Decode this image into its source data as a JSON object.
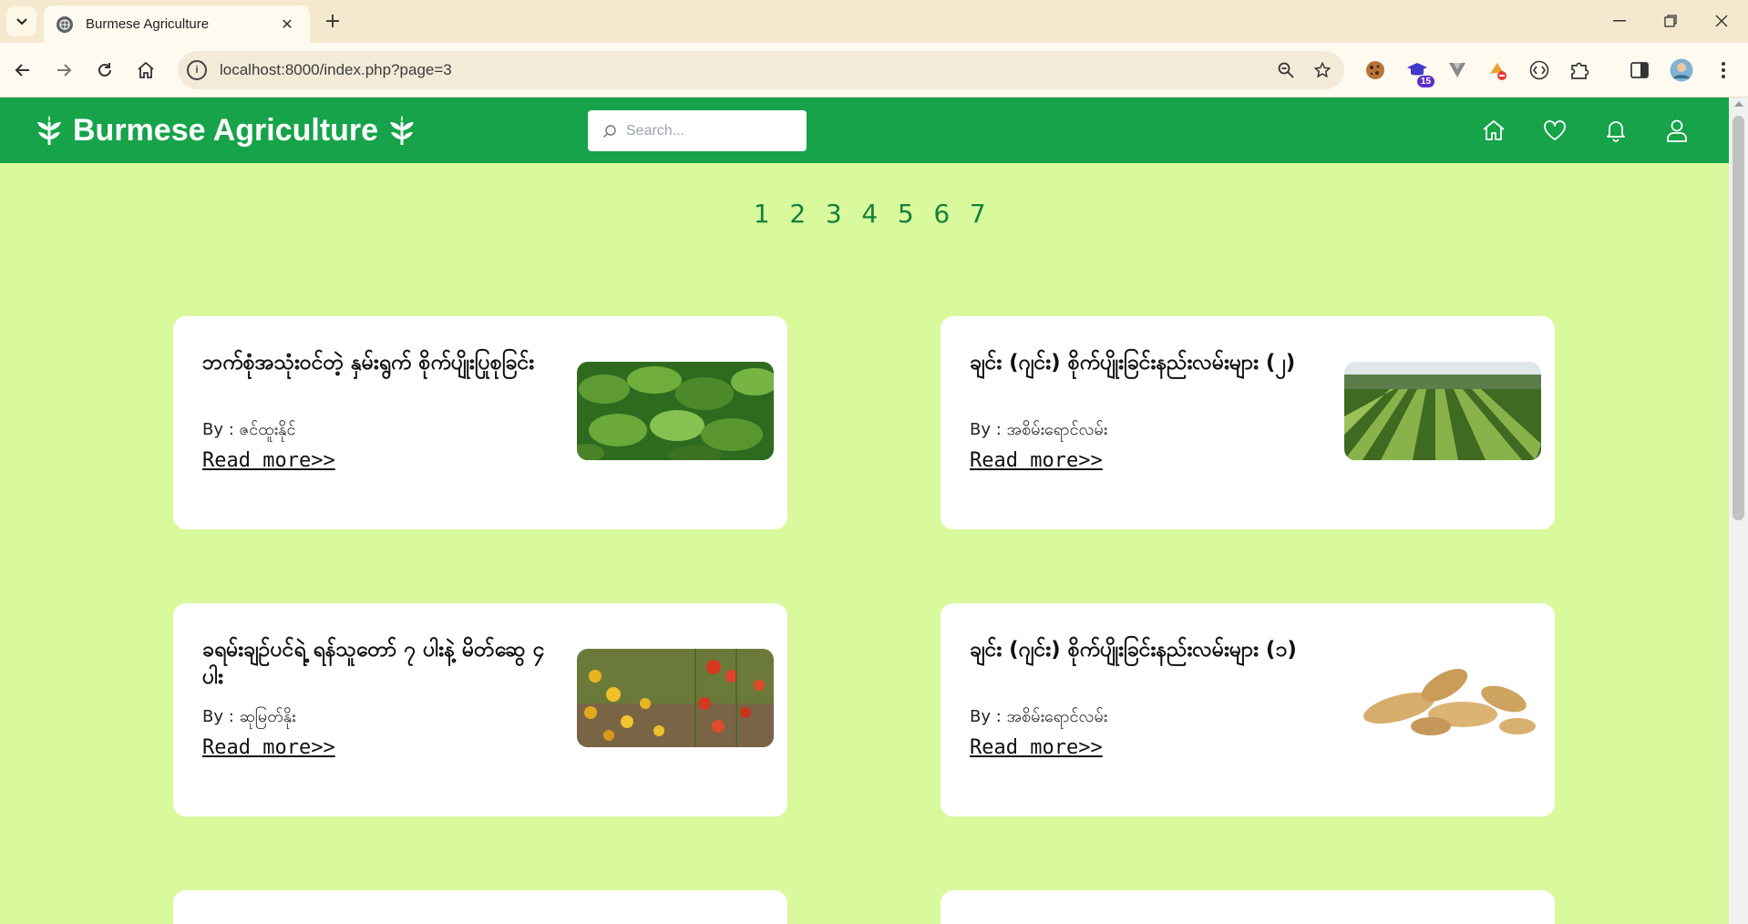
{
  "browser": {
    "tab_title": "Burmese Agriculture",
    "url": "localhost:8000/index.php?page=3",
    "extension_badge": "15"
  },
  "site": {
    "title": "Burmese Agriculture",
    "search_placeholder": "Search...",
    "accent_color": "#16a34a",
    "background_color": "#d9f99d"
  },
  "pagination": {
    "pages": [
      "1",
      "2",
      "3",
      "4",
      "5",
      "6",
      "7"
    ],
    "current": "3"
  },
  "posts": [
    {
      "title": "ဘက်စုံအသုံးဝင်တဲ့ နှမ်းရွက် စိုက်ပျိုးပြုစုခြင်း",
      "author": "By  :  ဇင်ထူးနိုင်",
      "read_more": "Read more>>"
    },
    {
      "title": "ချင်း (ဂျင်း) စိုက်ပျိုးခြင်းနည်းလမ်းများ (၂)",
      "author": "By  :  အစိမ်းရောင်လမ်း",
      "read_more": "Read more>>"
    },
    {
      "title": "ခရမ်းချဉ်ပင်ရဲ့ ရန်သူတော် ၇ ပါးနဲ့ မိတ်ဆွေ ၄ ပါး",
      "author": "By  :  ဆုမြတ်နိုး",
      "read_more": "Read more>>"
    },
    {
      "title": "ချင်း (ဂျင်း) စိုက်ပျိုးခြင်းနည်းလမ်းများ (၁)",
      "author": "By  :  အစိမ်းရောင်လမ်း",
      "read_more": "Read more>>"
    }
  ]
}
